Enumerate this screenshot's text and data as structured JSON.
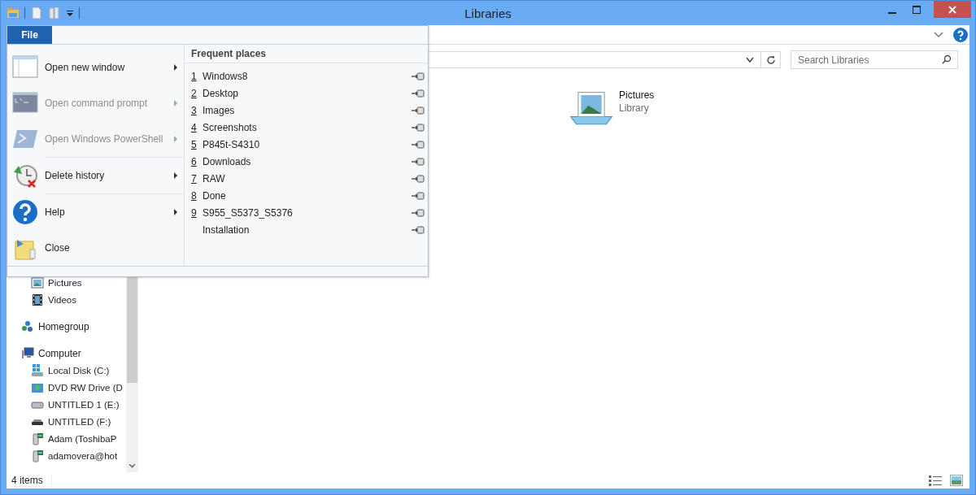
{
  "window": {
    "title": "Libraries"
  },
  "search": {
    "placeholder": "Search Libraries"
  },
  "nav_pane": {
    "libraries_children": [
      {
        "label": "Pictures",
        "kind": "pictures"
      },
      {
        "label": "Videos",
        "kind": "videos"
      }
    ],
    "homegroup": "Homegroup",
    "computer": {
      "label": "Computer",
      "children": [
        {
          "label": "Local Disk (C:)",
          "kind": "system-disk"
        },
        {
          "label": "DVD RW Drive (D",
          "kind": "dvd"
        },
        {
          "label": "UNTITLED 1 (E:)",
          "kind": "drive"
        },
        {
          "label": "UNTITLED (F:)",
          "kind": "removable"
        },
        {
          "label": "Adam (ToshibaP",
          "kind": "network"
        },
        {
          "label": "adamovera@hot",
          "kind": "network"
        }
      ]
    }
  },
  "content_items": [
    {
      "name": "Pictures",
      "type": "Library"
    }
  ],
  "status_bar": {
    "count": "4 items"
  },
  "file_menu": {
    "tab": "File",
    "commands": [
      {
        "label": "Open new window",
        "kind": "window",
        "disabled": false,
        "submenu": true
      },
      {
        "label": "Open command prompt",
        "kind": "cmd",
        "disabled": true,
        "submenu": true
      },
      {
        "label": "Open Windows PowerShell",
        "kind": "powershell",
        "disabled": true,
        "submenu": true
      },
      {
        "label": "Delete history",
        "kind": "history",
        "disabled": false,
        "submenu": true
      },
      {
        "label": "Help",
        "kind": "help",
        "disabled": false,
        "submenu": true
      },
      {
        "label": "Close",
        "kind": "close",
        "disabled": false,
        "submenu": false
      }
    ],
    "frequent_title": "Frequent places",
    "places": [
      {
        "number": "1",
        "label": "Windows8"
      },
      {
        "number": "2",
        "label": "Desktop"
      },
      {
        "number": "3",
        "label": "Images"
      },
      {
        "number": "4",
        "label": "Screenshots"
      },
      {
        "number": "5",
        "label": "P845t-S4310"
      },
      {
        "number": "6",
        "label": "Downloads"
      },
      {
        "number": "7",
        "label": "RAW"
      },
      {
        "number": "8",
        "label": "Done"
      },
      {
        "number": "9",
        "label": "S955_S5373_S5376"
      },
      {
        "label": "Installation"
      }
    ]
  }
}
